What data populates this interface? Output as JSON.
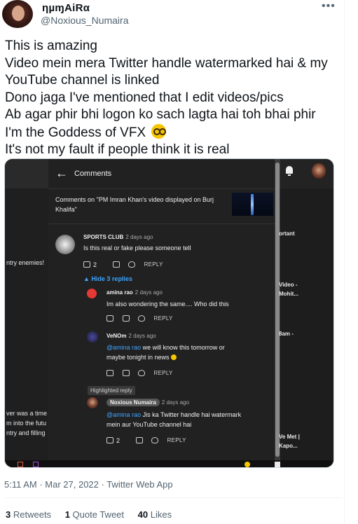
{
  "author": {
    "display_name": "ηµɱAiRα",
    "handle": "@Noxious_Numaira"
  },
  "more_icon": "more-horizontal-icon",
  "tweet": {
    "lines": [
      "This is amazing",
      "Video mein mera Twitter handle watermarked hai & my",
      "YouTube channel is linked",
      "Dono jaga I've mentioned that I edit videos/pics",
      "Ab agar phir bhi logon ko sach lagta hai toh bhai phir",
      "I'm the Goddess of VFX",
      "It's not my fault if people think it is real"
    ],
    "emoji": "nerd-face-emoji"
  },
  "media": {
    "panel_title": "Comments",
    "video_caption": "Comments on \"PM Imran Khan's video displayed on Burj Khalifa\"",
    "left_texts": [
      "ntry enemies!",
      "ver was a time",
      "m into the futu",
      "ntry and filling"
    ],
    "right_texts": [
      "ortant",
      "Video -",
      "Mohit...",
      "8am -",
      "Ve Met |",
      "Kapo..."
    ],
    "comments": [
      {
        "name": "SPORTS CLUB",
        "time": "2 days ago",
        "text": [
          "Is this real or fake please someone tell"
        ],
        "likes": "2",
        "reply_label": "REPLY"
      }
    ],
    "hide_replies": "Hide 3 replies",
    "replies": [
      {
        "name": "amina rao",
        "time": "2 days ago",
        "text": [
          "Im also wondering the same.... Who did this"
        ],
        "reply_label": "REPLY"
      },
      {
        "name": "VeNOm",
        "time": "2 days ago",
        "mention": "@amina rao",
        "text": [
          " we will know this tomorrow or",
          "maybe tonight in news"
        ],
        "reply_label": "REPLY"
      }
    ],
    "highlighted_label": "Highlighted reply",
    "highlighted": {
      "name": "Noxious Numaira",
      "time": "2 days ago",
      "mention": "@amina rao",
      "text": [
        " Jis ka Twitter handle hai watermark",
        "mein aur YouTube channel hai"
      ],
      "likes": "2",
      "reply_label": "REPLY"
    }
  },
  "timestamp": "5:11 AM · Mar 27, 2022 · Twitter Web App",
  "stats": {
    "retweets_count": "3",
    "retweets_label": "Retweets",
    "quotes_count": "1",
    "quotes_label": "Quote Tweet",
    "likes_count": "40",
    "likes_label": "Likes"
  }
}
